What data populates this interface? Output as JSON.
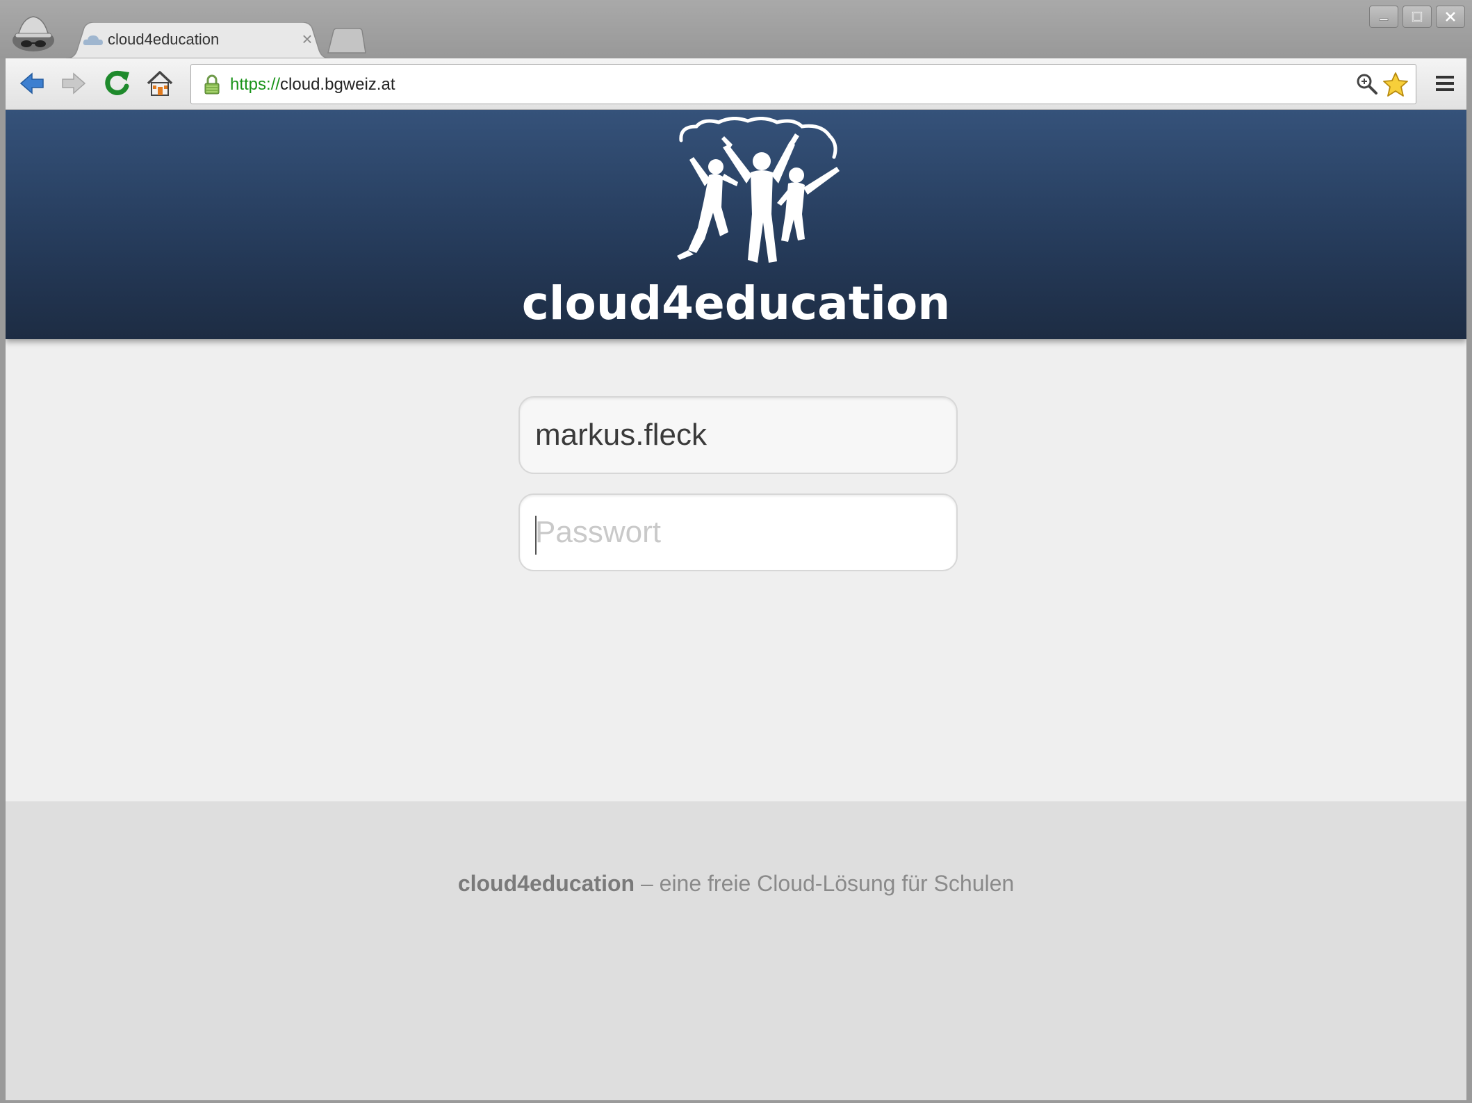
{
  "browser": {
    "tab": {
      "title": "cloud4education",
      "close_symbol": "×"
    },
    "address_bar": {
      "scheme": "https://",
      "host": "cloud.bgweiz.at"
    },
    "icons": {
      "incognito": "incognito-icon",
      "back": "back-arrow-icon",
      "forward": "forward-arrow-icon",
      "reload": "reload-icon",
      "home": "home-icon",
      "lock": "lock-icon",
      "zoom": "zoom-icon",
      "bookmark": "star-icon",
      "menu": "menu-icon"
    }
  },
  "page": {
    "logo": {
      "wordmark": "cloud4education"
    },
    "login": {
      "username_value": "markus.fleck",
      "password_placeholder": "Passwort"
    },
    "footer": {
      "brand": "cloud4education",
      "tagline": " – eine freie Cloud-Lösung für Schulen"
    }
  },
  "colors": {
    "header_top": "#35527a",
    "header_bottom": "#1d2c43",
    "url_scheme": "#199319",
    "page_bg": "#efefef",
    "footer_bg": "#dedede"
  }
}
